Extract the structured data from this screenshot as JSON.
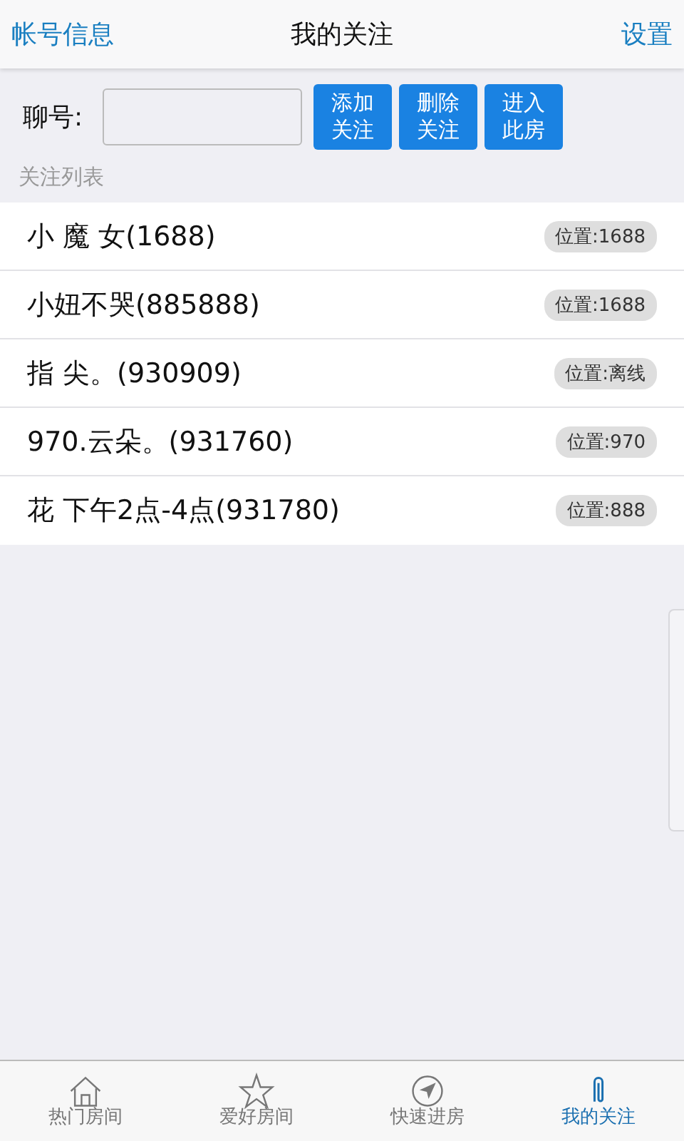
{
  "header": {
    "left": "帐号信息",
    "title": "我的关注",
    "right": "设置"
  },
  "form": {
    "label": "聊号:",
    "buttons": [
      "添加关注",
      "删除关注",
      "进入此房"
    ]
  },
  "section_title": "关注列表",
  "follows": [
    {
      "name": "小 魔 女(1688)",
      "location": "位置:1688"
    },
    {
      "name": "小妞不哭(885888)",
      "location": "位置:1688"
    },
    {
      "name": "指 尖。(930909)",
      "location": "位置:离线"
    },
    {
      "name": "970.云朵。(931760)",
      "location": "位置:970"
    },
    {
      "name": "花 下午2点-4点(931780)",
      "location": "位置:888"
    }
  ],
  "tabs": [
    {
      "label": "热门房间",
      "selected": false
    },
    {
      "label": "爱好房间",
      "selected": false
    },
    {
      "label": "快速进房",
      "selected": false
    },
    {
      "label": "我的关注",
      "selected": true
    }
  ]
}
